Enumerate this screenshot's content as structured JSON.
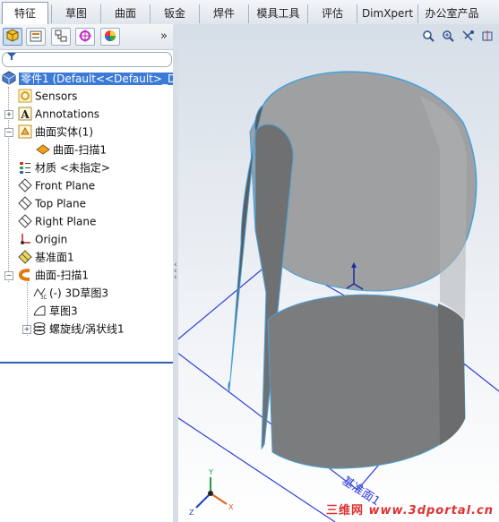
{
  "tabs": [
    {
      "label": "特征",
      "active": true
    },
    {
      "label": "草图"
    },
    {
      "label": "曲面"
    },
    {
      "label": "钣金"
    },
    {
      "label": "焊件"
    },
    {
      "label": "模具工具"
    },
    {
      "label": "评估"
    },
    {
      "label": "DimXpert"
    },
    {
      "label": "办公室产品"
    }
  ],
  "panel_icons": [
    "feature-manager-icon",
    "property-manager-icon",
    "configuration-manager-icon",
    "dimxpert-manager-icon",
    "display-manager-icon"
  ],
  "panel_more": "»",
  "filter_icon": "funnel-icon",
  "tree": [
    {
      "label": "零件1  (Default<<Default>_Di",
      "icon": "part-icon",
      "selected": true
    },
    {
      "label": "Sensors",
      "icon": "sensors-icon"
    },
    {
      "label": "Annotations",
      "icon": "annotations-icon"
    },
    {
      "label": "曲面实体(1)",
      "icon": "surface-bodies-icon"
    },
    {
      "label": "曲面-扫描1",
      "icon": "surface-body-icon"
    },
    {
      "label": "材质 <未指定>",
      "icon": "material-icon"
    },
    {
      "label": "Front Plane",
      "icon": "plane-icon"
    },
    {
      "label": "Top Plane",
      "icon": "plane-icon"
    },
    {
      "label": "Right Plane",
      "icon": "plane-icon"
    },
    {
      "label": "Origin",
      "icon": "origin-icon"
    },
    {
      "label": "基准面1",
      "icon": "plane-yellow-icon"
    },
    {
      "label": "曲面-扫描1",
      "icon": "sweep-icon"
    },
    {
      "label": "(-) 3D草图3",
      "icon": "3d-sketch-icon"
    },
    {
      "label": "草图3",
      "icon": "sketch-icon"
    },
    {
      "label": "螺旋线/涡状线1",
      "icon": "helix-icon"
    }
  ],
  "view_tools": [
    "zoom-to-fit-icon",
    "zoom-area-icon",
    "view-orientation-icon",
    "section-view-icon"
  ],
  "plane_label": "基准面1",
  "watermark": {
    "site": "三维网",
    "url": "www.3dportal.cn"
  },
  "colors": {
    "selection": "#3d7ad8",
    "surface": "#808284",
    "edge": "#4aa0d8",
    "plane": "#2f3fd8"
  }
}
